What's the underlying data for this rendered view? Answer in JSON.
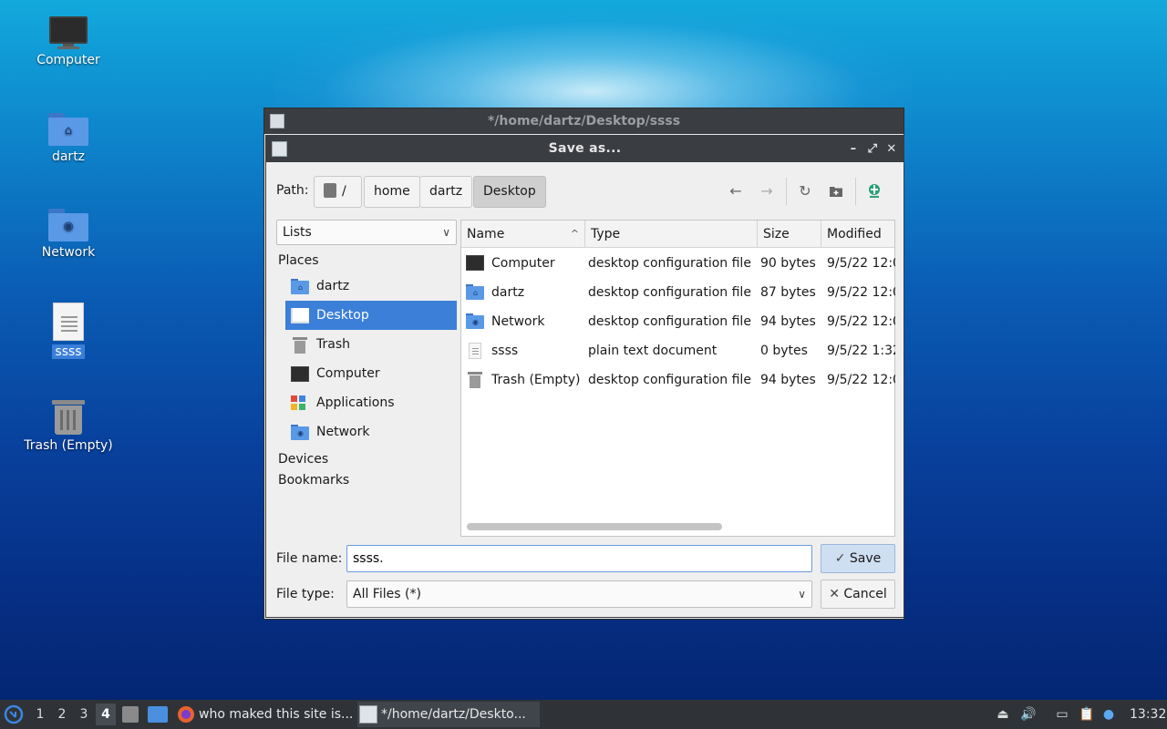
{
  "desktop": {
    "icons": [
      {
        "label": "Computer",
        "icon": "computer-icon"
      },
      {
        "label": "dartz",
        "icon": "home-folder-icon"
      },
      {
        "label": "Network",
        "icon": "network-folder-icon"
      },
      {
        "label": "ssss",
        "icon": "text-file-icon",
        "selected": true
      },
      {
        "label": "Trash (Empty)",
        "icon": "trash-icon"
      }
    ]
  },
  "parent_window": {
    "title": "*/home/dartz/Desktop/ssss"
  },
  "dialog": {
    "title": "Save as...",
    "controls": {
      "minimize": "–",
      "maximize": "⤢",
      "close": "✕"
    },
    "path_label": "Path:",
    "breadcrumbs": [
      "/",
      "home",
      "dartz",
      "Desktop"
    ],
    "active_crumb": "Desktop",
    "toolbar": {
      "back": "←",
      "forward": "→",
      "reload": "↻",
      "new_folder": "new-folder-icon",
      "bookmark": "bookmark-icon"
    },
    "side_view_select": "Lists",
    "sidebar": {
      "places_header": "Places",
      "places": [
        {
          "label": "dartz",
          "icon": "home-folder-icon"
        },
        {
          "label": "Desktop",
          "icon": "desktop-icon",
          "selected": true
        },
        {
          "label": "Trash",
          "icon": "trash-icon"
        },
        {
          "label": "Computer",
          "icon": "computer-icon"
        },
        {
          "label": "Applications",
          "icon": "applications-icon"
        },
        {
          "label": "Network",
          "icon": "network-folder-icon"
        }
      ],
      "devices_header": "Devices",
      "bookmarks_header": "Bookmarks"
    },
    "file_list": {
      "columns": [
        "Name",
        "Type",
        "Size",
        "Modified"
      ],
      "sort_indicator": "^",
      "rows": [
        {
          "name": "Computer",
          "type": "desktop configuration file",
          "size": "90 bytes",
          "modified": "9/5/22 12:0",
          "icon": "computer-icon"
        },
        {
          "name": "dartz",
          "type": "desktop configuration file",
          "size": "87 bytes",
          "modified": "9/5/22 12:0",
          "icon": "home-folder-icon"
        },
        {
          "name": "Network",
          "type": "desktop configuration file",
          "size": "94 bytes",
          "modified": "9/5/22 12:0",
          "icon": "network-folder-icon"
        },
        {
          "name": "ssss",
          "type": "plain text document",
          "size": "0 bytes",
          "modified": "9/5/22 1:32",
          "icon": "text-file-icon"
        },
        {
          "name": "Trash (Empty)",
          "type": "desktop configuration file",
          "size": "94 bytes",
          "modified": "9/5/22 12:0",
          "icon": "trash-icon"
        }
      ]
    },
    "file_name_label": "File name:",
    "file_name_value": "ssss.",
    "file_type_label": "File type:",
    "file_type_value": "All Files (*)",
    "save_label": "Save",
    "cancel_label": "Cancel"
  },
  "taskbar": {
    "workspaces": [
      "1",
      "2",
      "3",
      "4"
    ],
    "current_workspace": "4",
    "tasks": [
      {
        "label": "who maked this site is...",
        "icon": "firefox-icon"
      },
      {
        "label": "*/home/dartz/Deskto...",
        "icon": "text-editor-icon"
      }
    ],
    "clock": "13:32"
  },
  "colors": {
    "selection": "#3b7fd8",
    "titlebar": "#3a3d42",
    "taskbar": "#2f3338"
  }
}
